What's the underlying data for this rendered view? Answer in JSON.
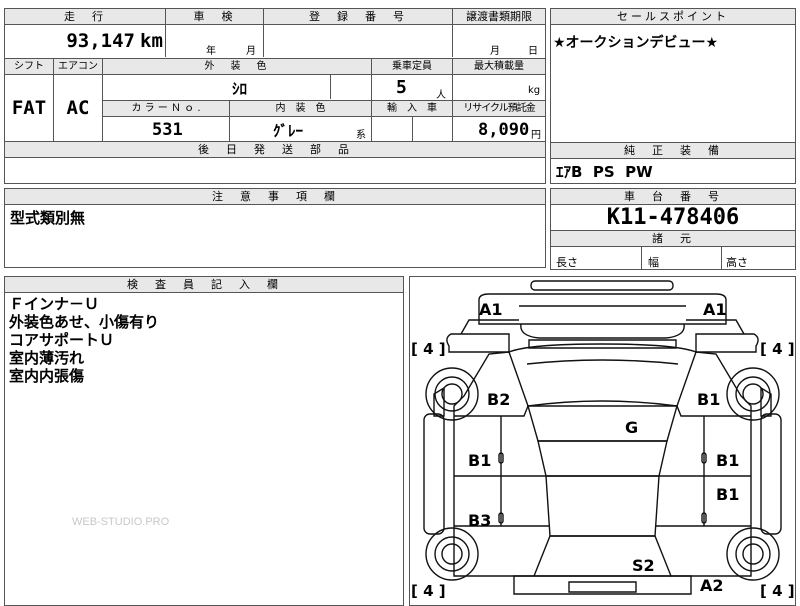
{
  "header": {
    "distance_label": "走　行",
    "inspection_label": "車　検",
    "registration_label": "登　録　番　号",
    "transfer_label": "譲渡書類期限",
    "sales_point_label": "セールスポイント"
  },
  "vehicle": {
    "distance": "93,147",
    "distance_unit": "km",
    "inspection_year_unit": "年",
    "inspection_month_unit": "月",
    "transfer_month_unit": "月",
    "transfer_day_unit": "日",
    "sales_point": "★オークションデビュー★"
  },
  "specs": {
    "shift_label": "シフト",
    "ac_label": "エアコン",
    "exterior_color_label": "外　装　色",
    "capacity_label": "乗車定員",
    "max_load_label": "最大積載量",
    "shift": "FAT",
    "ac": "AC",
    "exterior_color": "ｼﾛ",
    "capacity": "5",
    "capacity_unit": "人",
    "max_load_unit": "kg",
    "color_no_label": "カ ラ ー Ｎ ｏ .",
    "interior_color_label": "内　装　色",
    "import_label": "輸　入　車",
    "recycle_label": "リサイクル預託金",
    "color_no": "531",
    "interior_color": "ｸﾞﾚｰ",
    "interior_color_suffix": "系",
    "recycle_fee": "8,090",
    "recycle_unit": "円",
    "delivery_parts_label": "後　日　発　送　部　品",
    "genuine_equipment_label": "純　正　装　備",
    "genuine_equipment": "ｴｱB  PS  PW"
  },
  "notes": {
    "caution_label": "注　意　事　項　欄",
    "caution_text": "型式類別無",
    "chassis_label": "車　台　番　号",
    "chassis_number": "K11-478406",
    "dimensions_label": "諸　元",
    "length_label": "長さ",
    "width_label": "幅",
    "height_label": "高さ"
  },
  "inspector": {
    "label": "検　査　員　記　入　欄",
    "lines": [
      "Ｆインナ－Ｕ",
      "外装色あせ、小傷有り",
      "コアサポートＵ",
      "室内薄汚れ",
      "室内内張傷"
    ]
  },
  "diagram": {
    "marks": {
      "a1_left": "A1",
      "a1_right": "A1",
      "b2": "B2",
      "b1_right_top": "B1",
      "g": "G",
      "b1_left": "B1",
      "b1_right_mid": "B1",
      "b1_right_low": "B1",
      "b3": "B3",
      "s2": "S2",
      "a2": "A2"
    },
    "tire_counts": {
      "front_left": "4",
      "front_right": "4",
      "rear_left": "4",
      "rear_right": "4"
    }
  },
  "watermark": "WEB-STUDIO.PRO"
}
